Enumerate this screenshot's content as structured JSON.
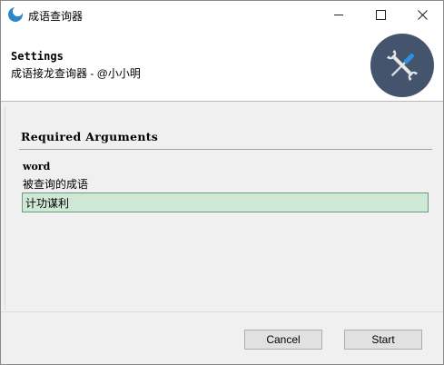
{
  "window": {
    "title": "成语查询器",
    "controls": {
      "minimize": "minimize",
      "maximize": "maximize",
      "close": "close"
    }
  },
  "header": {
    "title": "Settings",
    "subtitle": "成语接龙查询器 - @小小明",
    "logo_icon": "tools-icon",
    "logo_color": "#44546c"
  },
  "section": {
    "title": "Required Arguments",
    "argument": {
      "name": "word",
      "help": "被查询的成语",
      "value": "计功谋利"
    }
  },
  "footer": {
    "cancel_label": "Cancel",
    "start_label": "Start"
  },
  "colors": {
    "input_bg": "#cfe8d6",
    "input_border": "#6a9a80"
  }
}
